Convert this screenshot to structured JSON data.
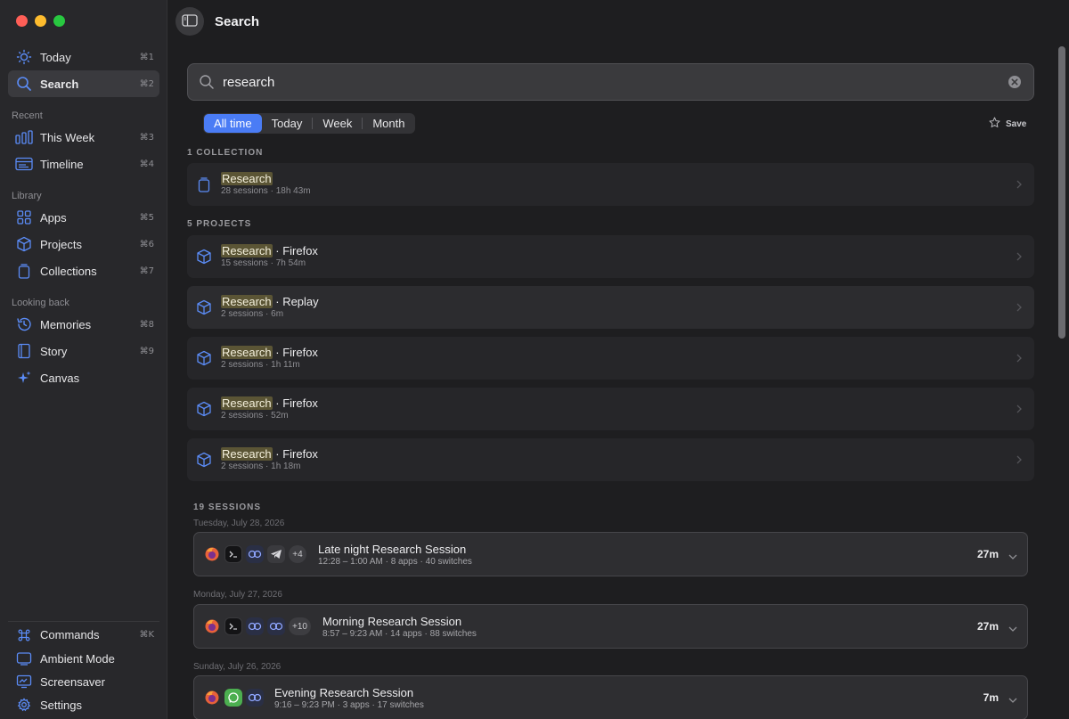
{
  "colors": {
    "accent": "#4a7cf5",
    "highlight": "#5b5535",
    "close": "#ff5f57",
    "minimize": "#febc2e",
    "zoom": "#28c840"
  },
  "sidebar": {
    "primary": [
      {
        "label": "Today",
        "shortcut": "⌘1",
        "icon": "sun-icon"
      },
      {
        "label": "Search",
        "shortcut": "⌘2",
        "icon": "search-icon",
        "active": true
      }
    ],
    "recent_label": "Recent",
    "recent": [
      {
        "label": "This Week",
        "shortcut": "⌘3",
        "icon": "bar-chart-icon"
      },
      {
        "label": "Timeline",
        "shortcut": "⌘4",
        "icon": "timeline-icon"
      }
    ],
    "library_label": "Library",
    "library": [
      {
        "label": "Apps",
        "shortcut": "⌘5",
        "icon": "grid-icon"
      },
      {
        "label": "Projects",
        "shortcut": "⌘6",
        "icon": "cube-icon"
      },
      {
        "label": "Collections",
        "shortcut": "⌘7",
        "icon": "stack-icon"
      }
    ],
    "looking_back_label": "Looking back",
    "looking_back": [
      {
        "label": "Memories",
        "shortcut": "⌘8",
        "icon": "history-icon"
      },
      {
        "label": "Story",
        "shortcut": "⌘9",
        "icon": "book-icon"
      },
      {
        "label": "Canvas",
        "shortcut": "",
        "icon": "sparkle-icon"
      }
    ],
    "bottom": [
      {
        "label": "Commands",
        "shortcut": "⌘K",
        "icon": "command-icon"
      },
      {
        "label": "Ambient Mode",
        "shortcut": "",
        "icon": "ambient-icon"
      },
      {
        "label": "Screensaver",
        "shortcut": "",
        "icon": "screensaver-icon"
      },
      {
        "label": "Settings",
        "shortcut": "",
        "icon": "gear-icon"
      }
    ]
  },
  "header": {
    "title": "Search"
  },
  "search": {
    "value": "research",
    "placeholder": ""
  },
  "filters": {
    "options": [
      "All time",
      "Today",
      "Week",
      "Month"
    ],
    "selected": "All time",
    "save_label": "Save"
  },
  "collections": {
    "heading": "1 COLLECTION",
    "items": [
      {
        "match": "Research",
        "rest": "",
        "meta": "28 sessions · 18h 43m"
      }
    ]
  },
  "projects": {
    "heading": "5 PROJECTS",
    "items": [
      {
        "match": "Research",
        "rest": " · Firefox",
        "meta": "15 sessions · 7h 54m"
      },
      {
        "match": "Research",
        "rest": " · Replay",
        "meta": "2 sessions · 6m"
      },
      {
        "match": "Research",
        "rest": " · Firefox",
        "meta": "2 sessions · 1h 11m"
      },
      {
        "match": "Research",
        "rest": " · Firefox",
        "meta": "2 sessions · 52m"
      },
      {
        "match": "Research",
        "rest": " · Firefox",
        "meta": "2 sessions · 1h 18m"
      }
    ]
  },
  "sessions": {
    "heading": "19 SESSIONS",
    "groups": [
      {
        "date": "Tuesday, July 28, 2026",
        "title": "Late night Research Session",
        "meta": "12:28 – 1:00 AM · 8 apps · 40 switches",
        "duration": "27m",
        "apps": [
          "firefox-icon",
          "terminal-icon",
          "replay-icon",
          "telegram-icon"
        ],
        "more": "+4"
      },
      {
        "date": "Monday, July 27, 2026",
        "title": "Morning Research Session",
        "meta": "8:57 – 9:23 AM · 14 apps · 88 switches",
        "duration": "27m",
        "apps": [
          "firefox-icon",
          "terminal-icon",
          "replay-icon",
          "replay-icon"
        ],
        "more": "+10"
      },
      {
        "date": "Sunday, July 26, 2026",
        "title": "Evening Research Session",
        "meta": "9:16 – 9:23 PM · 3 apps · 17 switches",
        "duration": "7m",
        "apps": [
          "firefox-icon",
          "whatsapp-icon",
          "replay-icon"
        ],
        "more": ""
      }
    ]
  }
}
